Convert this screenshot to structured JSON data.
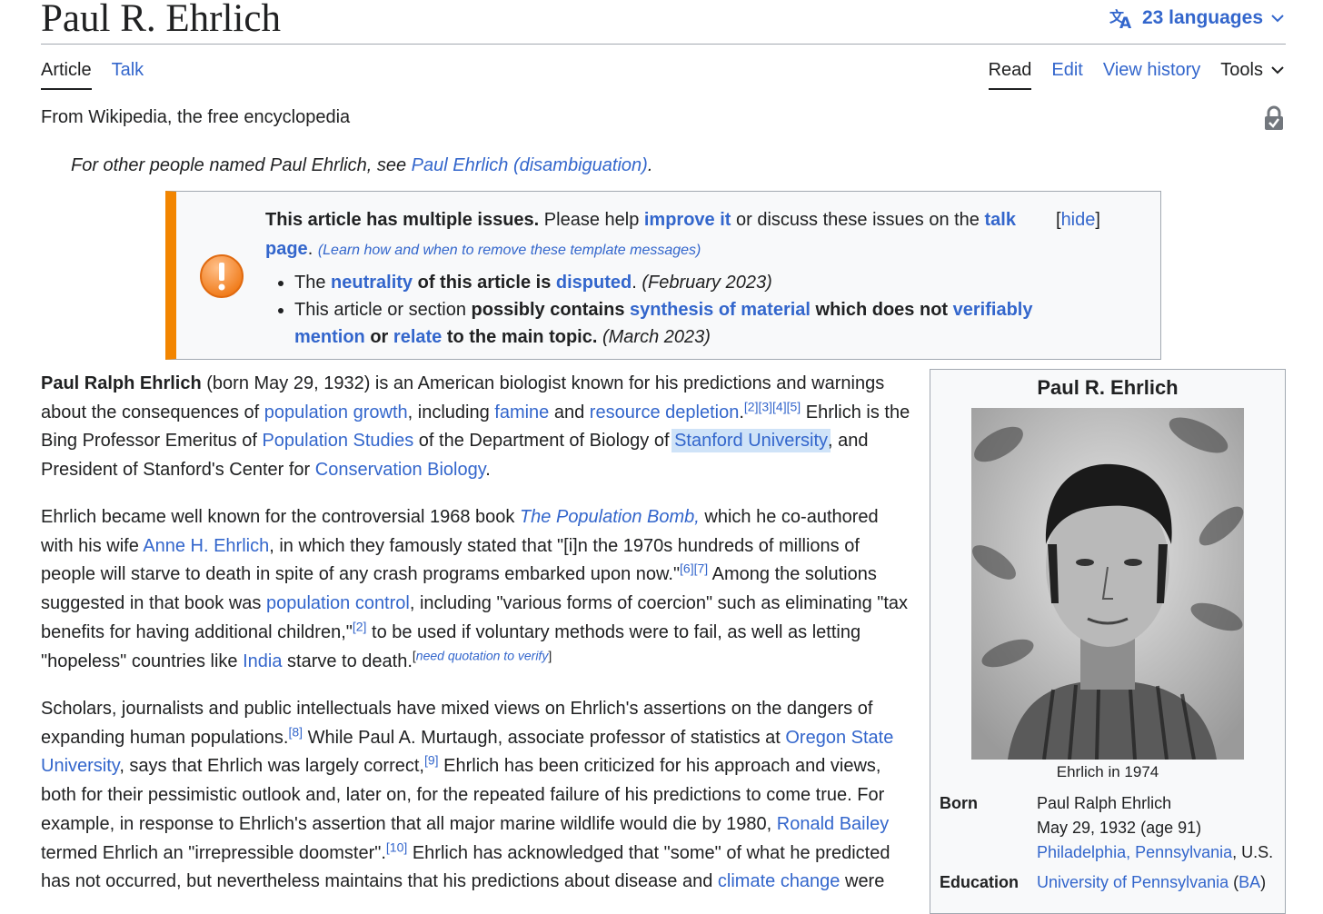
{
  "page": {
    "title": "Paul R. Ehrlich",
    "languages": "23 languages"
  },
  "tabs": {
    "article": "Article",
    "talk": "Talk",
    "read": "Read",
    "edit": "Edit",
    "history": "View history",
    "tools": "Tools"
  },
  "tagline": "From Wikipedia, the free encyclopedia",
  "hatnote": {
    "prefix": "For other people named Paul Ehrlich, see ",
    "link": "Paul Ehrlich (disambiguation)",
    "suffix": "."
  },
  "ambox": {
    "lead_bold": "This article has multiple issues.",
    "lead_text": " Please help ",
    "improve": "improve it",
    "mid": " or discuss these issues on the ",
    "talk_page": "talk page",
    "after": ". ",
    "learn": "(Learn how and when to remove these template messages)",
    "hide": "hide",
    "issue1": {
      "t1": "The ",
      "neutrality": "neutrality",
      "t2": " of this article is ",
      "disputed": "disputed",
      "t3": ". ",
      "date": "(February 2023)"
    },
    "issue2": {
      "t1": "This article or section ",
      "t2": "possibly contains ",
      "synthesis": "synthesis of material",
      "t3": " which does not ",
      "verif": "verifiably mention",
      "t4": " or ",
      "relate": "relate",
      "t5": " to the main topic.",
      "date": " (March 2023)"
    }
  },
  "p1": {
    "name": "Paul Ralph Ehrlich",
    "t1": " (born May 29, 1932) is an American biologist known for his predictions and warnings about the consequences of ",
    "l1": "population growth",
    "t2": ", including ",
    "l2": "famine",
    "t3": " and ",
    "l3": "resource depletion",
    "t4": ".",
    "refs1": "[2][3][4][5]",
    "t5": " Ehrlich is the Bing Professor Emeritus of ",
    "l4": "Population Studies",
    "t6": " of the Department of Biology of ",
    "l5": "Stanford University",
    "t7": ", and President of Stanford's Center for ",
    "l6": "Conservation Biology",
    "t8": "."
  },
  "p2": {
    "t1": "Ehrlich became well known for the controversial 1968 book ",
    "book": "The Population Bomb,",
    "t2": " which he co-authored with his wife ",
    "l1": "Anne H. Ehrlich",
    "t3": ", in which they famously stated that \"[i]n the 1970s hundreds of millions of people will starve to death in spite of any crash programs embarked upon now.\"",
    "refs1": "[6][7]",
    "t4": " Among the solutions suggested in that book was ",
    "l2": "population control",
    "t5": ", including \"various forms of coercion\" such as eliminating \"tax benefits for having additional children,\"",
    "refs2": "[2]",
    "t6": " to be used if voluntary methods were to fail, as well as letting \"hopeless\" countries like ",
    "l3": "India",
    "t7": " starve to death.",
    "needq": "need quotation to verify"
  },
  "p3": {
    "t1": "Scholars, journalists and public intellectuals have mixed views on Ehrlich's assertions on the dangers of expanding human populations.",
    "refs1": "[8]",
    "t2": " While Paul A. Murtaugh, associate professor of statistics at ",
    "l1": "Oregon State University",
    "t3": ", says that Ehrlich was largely correct,",
    "refs2": "[9]",
    "t4": " Ehrlich has been criticized for his approach and views, both for their pessimistic outlook and, later on, for the repeated failure of his predictions to come true. For example, in response to Ehrlich's assertion that all major marine wildlife would die by 1980, ",
    "l2": "Ronald Bailey",
    "t5": " termed Ehrlich an \"irrepressible doomster\".",
    "refs3": "[10]",
    "t6": " Ehrlich has acknowledged that \"some\" of what he predicted has not occurred, but nevertheless maintains that his predictions about disease and ",
    "l3": "climate change",
    "t7": " were"
  },
  "infobox": {
    "title": "Paul R. Ehrlich",
    "caption": "Ehrlich in 1974",
    "born_label": "Born",
    "born_name": "Paul Ralph Ehrlich",
    "born_date": "May 29, 1932 (age 91)",
    "born_place_link": "Philadelphia, Pennsylvania",
    "born_place_rest": ", U.S.",
    "edu_label": "Education",
    "edu_link": "University of Pennsylvania",
    "edu_open": " (",
    "edu_deg": "BA",
    "edu_close": ")"
  },
  "colors": {
    "link": "#3366cc",
    "ambox_bar": "#f28500",
    "highlight": "#cfe3f8"
  }
}
